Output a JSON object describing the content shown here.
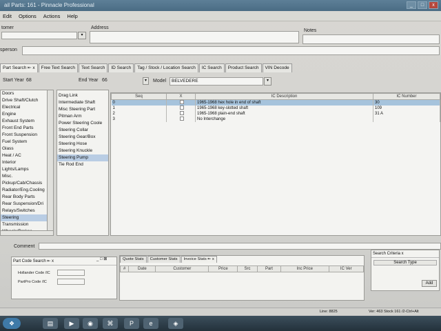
{
  "window": {
    "title": "ail Parts: 161 - Pinnacle Professional",
    "controls": {
      "minimize": "_",
      "maximize": "□",
      "close": "x"
    }
  },
  "menu": [
    "Edit",
    "Options",
    "Actions",
    "Help"
  ],
  "header": {
    "customer_label": "tomer",
    "address_label": "Address",
    "notes_label": "Notes",
    "salesperson_label": "sperson"
  },
  "tabs": [
    {
      "label": "Part Search  ⇤ x"
    },
    {
      "label": "Free Text Search"
    },
    {
      "label": "Text Search"
    },
    {
      "label": "ID Search"
    },
    {
      "label": "Tag / Stock / Location Search"
    },
    {
      "label": "IC Search"
    },
    {
      "label": "Product Search"
    },
    {
      "label": "VIN Decode"
    }
  ],
  "filters": {
    "start_year_label": "Start Year",
    "start_year": "68",
    "end_year_label": "End Year",
    "end_year": "66",
    "model_label": "Model",
    "model_value": "BELVEDERE"
  },
  "categories": [
    "Doors",
    "Drive Shaft/Clutch",
    "Electrical",
    "Engine",
    "Exhaust System",
    "Front End Parts",
    "Front Suspension",
    "Fuel System",
    "Glass",
    "Heat / AC",
    "Interior",
    "Lights/Lamps",
    "Misc.",
    "Pickup/Cab/Chassis",
    "Radiator/Eng.Cooling",
    "Rear Body Parts",
    "Rear Suspension/Dri",
    "Relays/Switches",
    "Steering",
    "Transmission",
    "Wheels/Brakes"
  ],
  "categories_selected": "Steering",
  "parts": [
    "Drag Link",
    "Intermediate Shaft",
    "Misc Steering Part",
    "Pitman Arm",
    "Power Steering Coole",
    "Steering Collar",
    "Steering Gear/Box",
    "Steering Hose",
    "Steering Knuckle",
    "Steering Pump",
    "Tie Rod End"
  ],
  "parts_selected": "Steering Pump",
  "ic_table": {
    "headers": [
      "Seq",
      "X",
      "IC Description",
      "IC Number"
    ],
    "rows": [
      {
        "seq": "0",
        "desc": "1965-1968 hex hole in end of shaft",
        "num": "30"
      },
      {
        "seq": "1",
        "desc": "1965-1968 key-slotted shaft",
        "num": "109"
      },
      {
        "seq": "2",
        "desc": "1965-1968 plain-end shaft",
        "num": "31   A"
      },
      {
        "seq": "3",
        "desc": "No Interchange",
        "num": ""
      }
    ]
  },
  "comment_label": "Comment",
  "part_code_search": {
    "title": "Part Code Search  ⇤ x",
    "hollander_label": "Hollander Code /IC",
    "partpro_label": "PartPro Code /IC"
  },
  "stats_tabs": [
    "Quote Stats",
    "Customer Stats",
    "Invoice Stats  ⇤ x"
  ],
  "stats_headers": [
    "#",
    "Date",
    "Customer",
    "Price",
    "Src",
    "Part",
    "Inc Price",
    "IC Ver"
  ],
  "search_criteria": {
    "title": "Search Criteria  x",
    "col": "Search Type",
    "button": "Add"
  },
  "status": {
    "left": "Line: 8825",
    "right": "Ver: 463 Stock 161 /2-Ctrl+Alt"
  }
}
